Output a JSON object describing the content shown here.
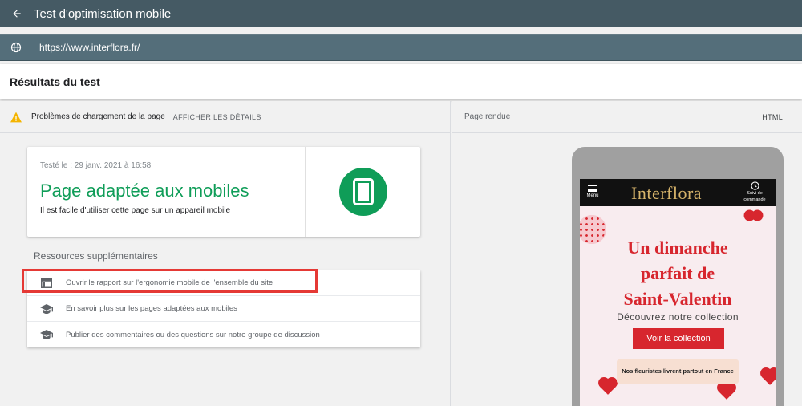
{
  "topbar": {
    "title": "Test d'optimisation mobile"
  },
  "urlbar": {
    "url": "https://www.interflora.fr/"
  },
  "results": {
    "heading": "Résultats du test"
  },
  "issues": {
    "text": "Problèmes de chargement de la page",
    "details_link": "AFFICHER LES DÉTAILS"
  },
  "verdict_card": {
    "tested": "Testé le : 29 janv. 2021 à 16:58",
    "title": "Page adaptée aux mobiles",
    "subtitle": "Il est facile d'utiliser cette page sur un appareil mobile",
    "accent_color": "#0f9d58"
  },
  "resources": {
    "title": "Ressources supplémentaires",
    "items": [
      {
        "icon": "web-page-icon",
        "label": "Ouvrir le rapport sur l'ergonomie mobile de l'ensemble du site"
      },
      {
        "icon": "school-cap-icon",
        "label": "En savoir plus sur les pages adaptées aux mobiles"
      },
      {
        "icon": "school-cap-icon",
        "label": "Publier des commentaires ou des questions sur notre groupe de discussion"
      }
    ]
  },
  "render_panel": {
    "label": "Page rendue",
    "html_tab": "HTML"
  },
  "rendered_site": {
    "menu_label": "Menu",
    "brand": "Interflora",
    "track_label_1": "Suivi de",
    "track_label_2": "commande",
    "promo_line_1": "Un dimanche",
    "promo_line_2": "parfait de",
    "promo_line_3": "Saint-Valentin",
    "promo_sub": "Découvrez notre collection",
    "cta": "Voir la collection",
    "notice": "Nos fleuristes livrent partout en France",
    "brand_color": "#d7262e"
  }
}
